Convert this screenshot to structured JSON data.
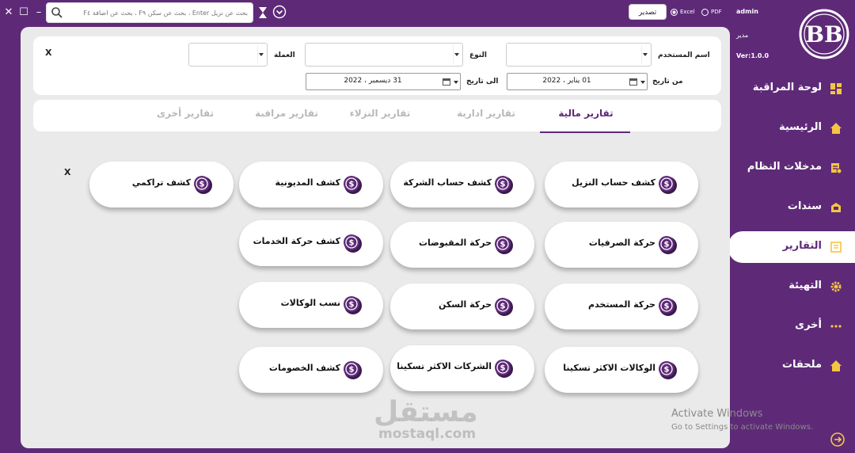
{
  "window": {
    "close": "✕",
    "maximize": "☐",
    "minimize": "–"
  },
  "search": {
    "placeholder": "بحث عن نزيل Enter ، بحث عن سكن F٩ ، بحث عن اضافة F٤"
  },
  "export": {
    "button_label": "تصدير",
    "options": [
      "Excel",
      "PDF"
    ],
    "selected": "Excel"
  },
  "user": {
    "name": "admin",
    "role": "مدير",
    "version": "Ver:1.0.0",
    "logo_text": "BB"
  },
  "sidebar": {
    "items": [
      {
        "label": "لوحة المراقبة",
        "icon": "dashboard-icon",
        "active": false
      },
      {
        "label": "الرئيسية",
        "icon": "home-icon",
        "active": false
      },
      {
        "label": "مدخلات النظام",
        "icon": "system-inputs-icon",
        "active": false
      },
      {
        "label": "سندات",
        "icon": "vouchers-icon",
        "active": false
      },
      {
        "label": "التقارير",
        "icon": "reports-icon",
        "active": true
      },
      {
        "label": "التهيئة",
        "icon": "settings-gear-icon",
        "active": false
      },
      {
        "label": "أخرى",
        "icon": "more-dots-icon",
        "active": false
      },
      {
        "label": "ملحقات",
        "icon": "attachments-home-icon",
        "active": false
      }
    ]
  },
  "filters": {
    "user_label": "اسم المستخدم",
    "type_label": "النوع",
    "currency_label": "العملة",
    "from_label": "من تاريخ",
    "to_label": "الى تاريخ",
    "from_date": "01   يناير  ، 2022",
    "to_date": "31  ديسمبر ، 2022",
    "close": "X"
  },
  "tabs": [
    {
      "label": "تقارير مالية",
      "active": true
    },
    {
      "label": "تقارير ادارية",
      "active": false
    },
    {
      "label": "تقارير النزلاء",
      "active": false
    },
    {
      "label": "تقارير مراقبة",
      "active": false
    },
    {
      "label": "تقارير أخرى",
      "active": false
    }
  ],
  "reports": {
    "close": "X",
    "buttons": [
      "كشف حساب النزيل",
      "كشف حساب الشركة",
      "كشف المديونية",
      "كشف تراكمي",
      "حركة الصرفيات",
      "حركة المقبوضات",
      "كشف حركة الخدمات",
      "حركة المستخدم",
      "حركة السكن",
      "نسب الوكالات",
      "الوكالات الاكثر تسكينا",
      "الشركات الاكثر تسكينا",
      "كشف الخصومات"
    ]
  },
  "overlay": {
    "activate_title": "Activate Windows",
    "activate_sub": "Go to Settings to activate Windows.",
    "watermark_ar": "مستقل",
    "watermark_en": "mostaql.com"
  },
  "colors": {
    "brand_purple": "#5e2a78",
    "panel_bg": "#eaeaea",
    "tab_inactive": "#b9b9b9"
  }
}
